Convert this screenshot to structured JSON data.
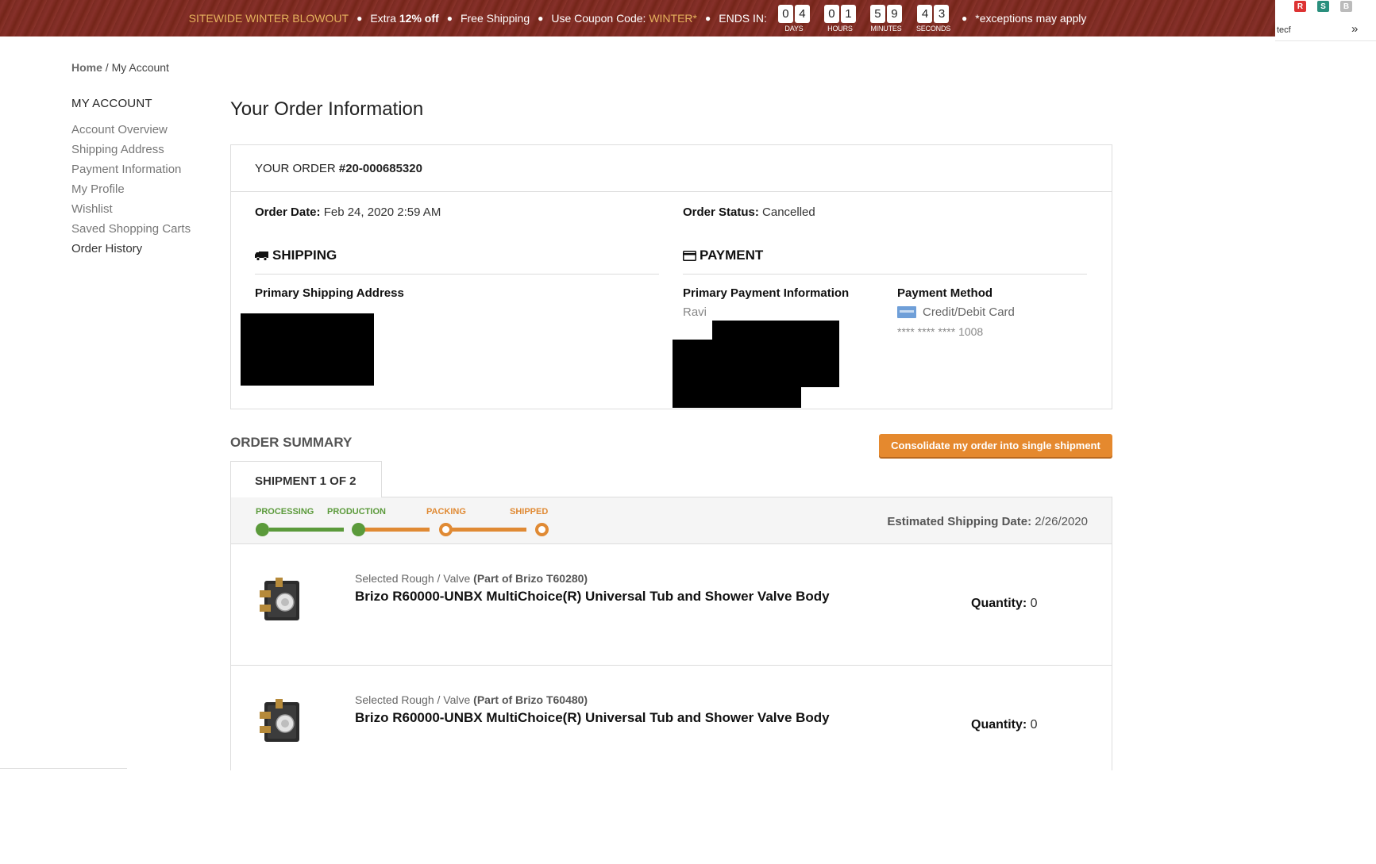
{
  "promo": {
    "title": "SITEWIDE WINTER BLOWOUT",
    "extra_prefix": "Extra",
    "extra_value": "12% off",
    "free_shipping": "Free Shipping",
    "coupon_prefix": "Use Coupon Code:",
    "coupon_code": "WINTER*",
    "ends_in": "ENDS IN:",
    "exceptions": "*exceptions may apply",
    "countdown": {
      "days": [
        "0",
        "4"
      ],
      "days_label": "DAYS",
      "hours": [
        "0",
        "1"
      ],
      "hours_label": "HOURS",
      "minutes": [
        "5",
        "9"
      ],
      "minutes_label": "MINUTES",
      "seconds": [
        "4",
        "3"
      ],
      "seconds_label": "SECONDS"
    }
  },
  "extension": {
    "text": "tecf",
    "chevron": "»",
    "icons": [
      "R",
      "S",
      "B"
    ]
  },
  "breadcrumb": {
    "home": "Home",
    "separator": "/",
    "current": "My Account"
  },
  "sidebar": {
    "heading": "MY ACCOUNT",
    "items": [
      {
        "label": "Account Overview"
      },
      {
        "label": "Shipping Address"
      },
      {
        "label": "Payment Information"
      },
      {
        "label": "My Profile"
      },
      {
        "label": "Wishlist"
      },
      {
        "label": "Saved Shopping Carts"
      },
      {
        "label": "Order History"
      }
    ]
  },
  "page_title": "Your Order Information",
  "order": {
    "label": "YOUR ORDER",
    "number": "#20-000685320",
    "date_label": "Order Date:",
    "date_value": "Feb 24, 2020 2:59 AM",
    "status_label": "Order Status:",
    "status_value": "Cancelled",
    "shipping_title": "SHIPPING",
    "primary_shipping_label": "Primary Shipping Address",
    "payment_title": "PAYMENT",
    "primary_payment_label": "Primary Payment Information",
    "payer_name_visible": "Ravi",
    "payment_method_label": "Payment Method",
    "payment_method_value": "Credit/Debit Card",
    "card_mask": "**** **** ****",
    "card_last4": "1008"
  },
  "summary": {
    "title": "ORDER SUMMARY",
    "consolidate_label": "Consolidate my order into single shipment",
    "shipment_tab": "SHIPMENT 1 OF 2",
    "steps": [
      "PROCESSING",
      "PRODUCTION",
      "PACKING",
      "SHIPPED"
    ],
    "completed_steps": 2,
    "est_label": "Estimated Shipping Date:",
    "est_value": "2/26/2020",
    "items": [
      {
        "selected_prefix": "Selected Rough / Valve",
        "part_of": "(Part of Brizo T60280)",
        "name": "Brizo R60000-UNBX MultiChoice(R) Universal Tub and Shower Valve Body",
        "qty_label": "Quantity:",
        "qty_value": "0"
      },
      {
        "selected_prefix": "Selected Rough / Valve",
        "part_of": "(Part of Brizo T60480)",
        "name": "Brizo R60000-UNBX MultiChoice(R) Universal Tub and Shower Valve Body",
        "qty_label": "Quantity:",
        "qty_value": "0"
      }
    ]
  },
  "colors": {
    "banner": "#7a2a21",
    "gold": "#e5b25d",
    "accent_orange": "#e5892e",
    "progress_done": "#5b9a3b",
    "progress_todo": "#e08a34"
  }
}
